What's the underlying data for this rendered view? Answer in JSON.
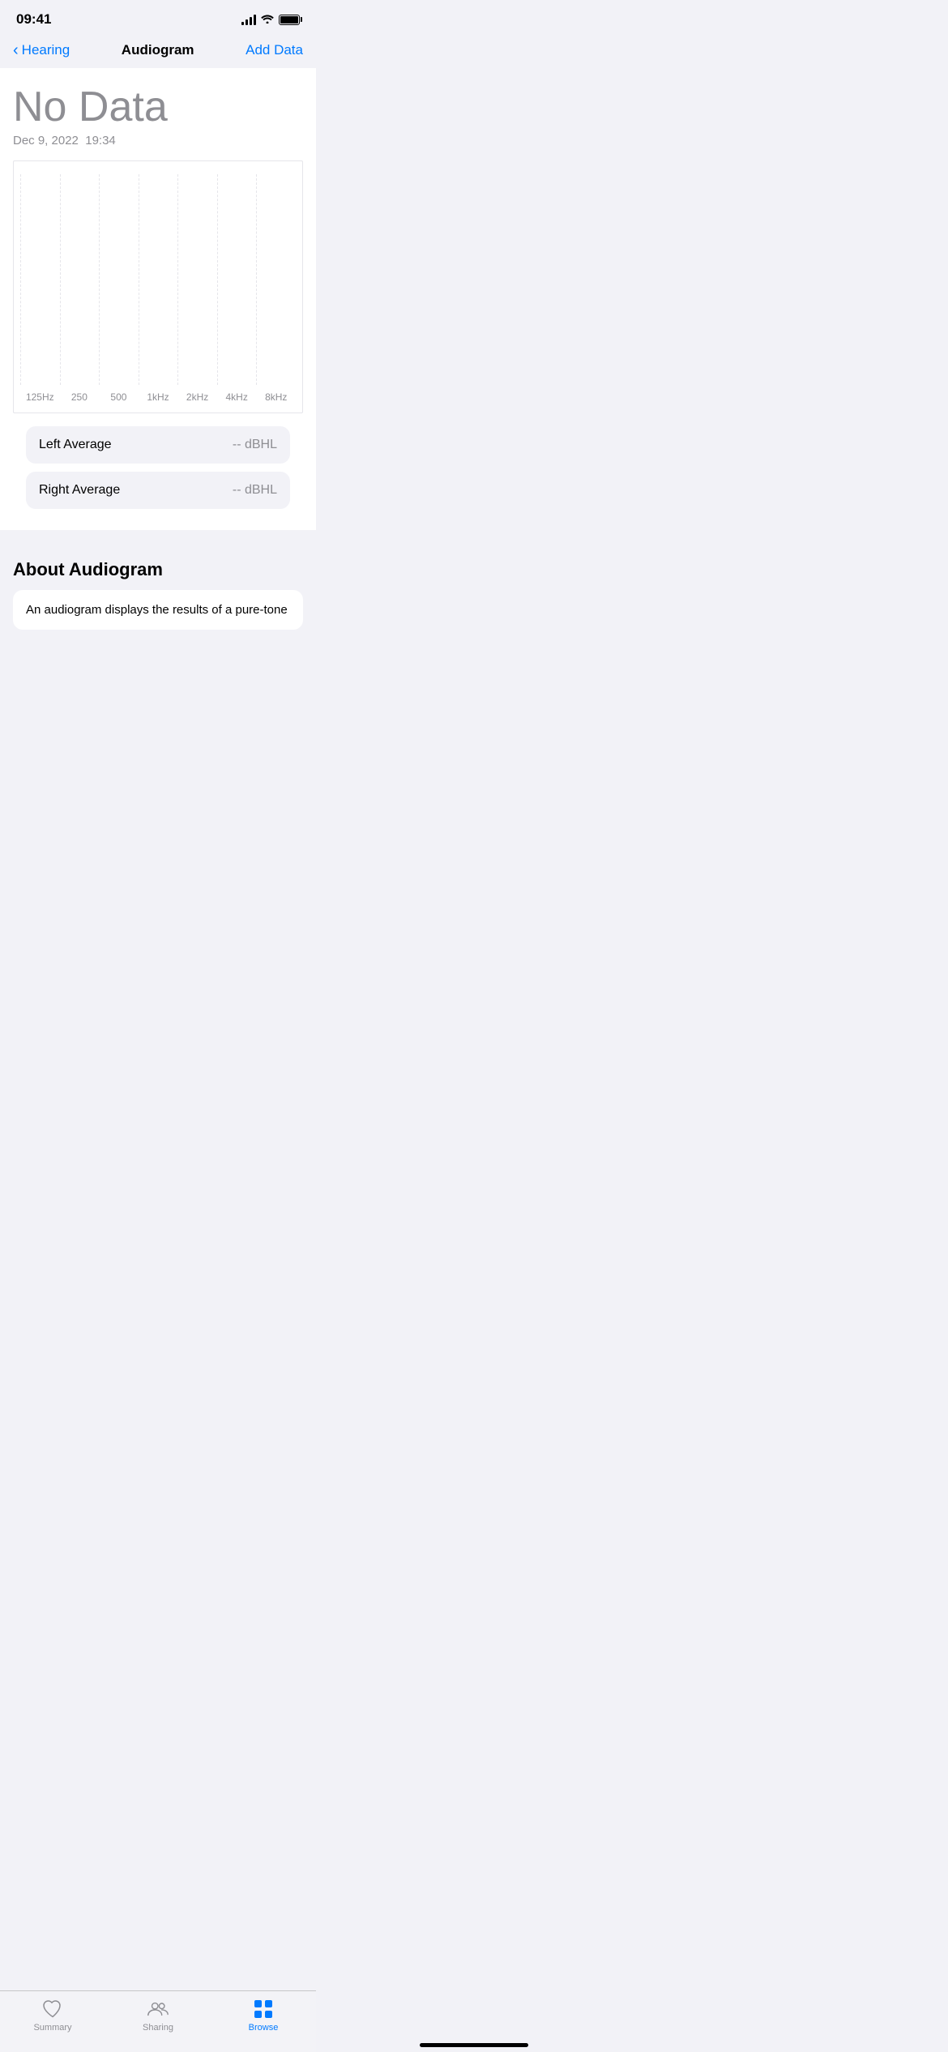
{
  "statusBar": {
    "time": "09:41",
    "battery": "full"
  },
  "navBar": {
    "backLabel": "Hearing",
    "title": "Audiogram",
    "actionLabel": "Add Data"
  },
  "chart": {
    "dataTitle": "No Data",
    "dateLabel": "Dec 9, 2022",
    "timeLabel": "19:34",
    "xAxisLabels": [
      "125Hz",
      "250",
      "500",
      "1kHz",
      "2kHz",
      "4kHz",
      "8kHz"
    ]
  },
  "infoCards": [
    {
      "label": "Left Average",
      "value": "-- dBHL"
    },
    {
      "label": "Right Average",
      "value": "-- dBHL"
    }
  ],
  "aboutSection": {
    "title": "About Audiogram",
    "text": "An audiogram displays the results of a pure-tone..."
  },
  "tabBar": {
    "items": [
      {
        "id": "summary",
        "label": "Summary",
        "active": false
      },
      {
        "id": "sharing",
        "label": "Sharing",
        "active": false
      },
      {
        "id": "browse",
        "label": "Browse",
        "active": true
      }
    ]
  }
}
